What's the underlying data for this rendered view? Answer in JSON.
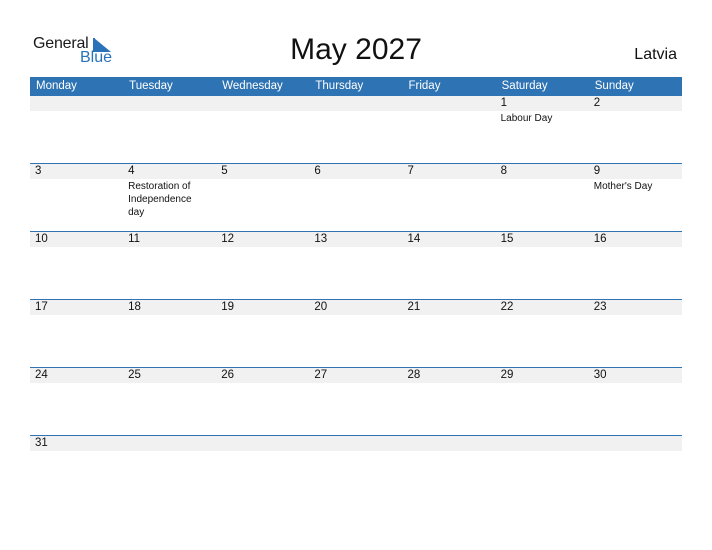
{
  "logo": {
    "general": "General",
    "blue": "Blue",
    "colors": {
      "blue": "#2b73b8"
    }
  },
  "title": "May 2027",
  "country": "Latvia",
  "colors": {
    "header_bg": "#2e73b3",
    "header_text": "#ffffff",
    "date_band": "#f1f1f1"
  },
  "weekdays": [
    "Monday",
    "Tuesday",
    "Wednesday",
    "Thursday",
    "Friday",
    "Saturday",
    "Sunday"
  ],
  "weeks": [
    {
      "days": [
        {
          "num": "",
          "holiday": ""
        },
        {
          "num": "",
          "holiday": ""
        },
        {
          "num": "",
          "holiday": ""
        },
        {
          "num": "",
          "holiday": ""
        },
        {
          "num": "",
          "holiday": ""
        },
        {
          "num": "1",
          "holiday": "Labour Day"
        },
        {
          "num": "2",
          "holiday": ""
        }
      ]
    },
    {
      "days": [
        {
          "num": "3",
          "holiday": ""
        },
        {
          "num": "4",
          "holiday": "Restoration of Independence day"
        },
        {
          "num": "5",
          "holiday": ""
        },
        {
          "num": "6",
          "holiday": ""
        },
        {
          "num": "7",
          "holiday": ""
        },
        {
          "num": "8",
          "holiday": ""
        },
        {
          "num": "9",
          "holiday": "Mother's Day"
        }
      ]
    },
    {
      "days": [
        {
          "num": "10",
          "holiday": ""
        },
        {
          "num": "11",
          "holiday": ""
        },
        {
          "num": "12",
          "holiday": ""
        },
        {
          "num": "13",
          "holiday": ""
        },
        {
          "num": "14",
          "holiday": ""
        },
        {
          "num": "15",
          "holiday": ""
        },
        {
          "num": "16",
          "holiday": ""
        }
      ]
    },
    {
      "days": [
        {
          "num": "17",
          "holiday": ""
        },
        {
          "num": "18",
          "holiday": ""
        },
        {
          "num": "19",
          "holiday": ""
        },
        {
          "num": "20",
          "holiday": ""
        },
        {
          "num": "21",
          "holiday": ""
        },
        {
          "num": "22",
          "holiday": ""
        },
        {
          "num": "23",
          "holiday": ""
        }
      ]
    },
    {
      "days": [
        {
          "num": "24",
          "holiday": ""
        },
        {
          "num": "25",
          "holiday": ""
        },
        {
          "num": "26",
          "holiday": ""
        },
        {
          "num": "27",
          "holiday": ""
        },
        {
          "num": "28",
          "holiday": ""
        },
        {
          "num": "29",
          "holiday": ""
        },
        {
          "num": "30",
          "holiday": ""
        }
      ]
    },
    {
      "days": [
        {
          "num": "31",
          "holiday": ""
        },
        {
          "num": "",
          "holiday": ""
        },
        {
          "num": "",
          "holiday": ""
        },
        {
          "num": "",
          "holiday": ""
        },
        {
          "num": "",
          "holiday": ""
        },
        {
          "num": "",
          "holiday": ""
        },
        {
          "num": "",
          "holiday": ""
        }
      ]
    }
  ]
}
